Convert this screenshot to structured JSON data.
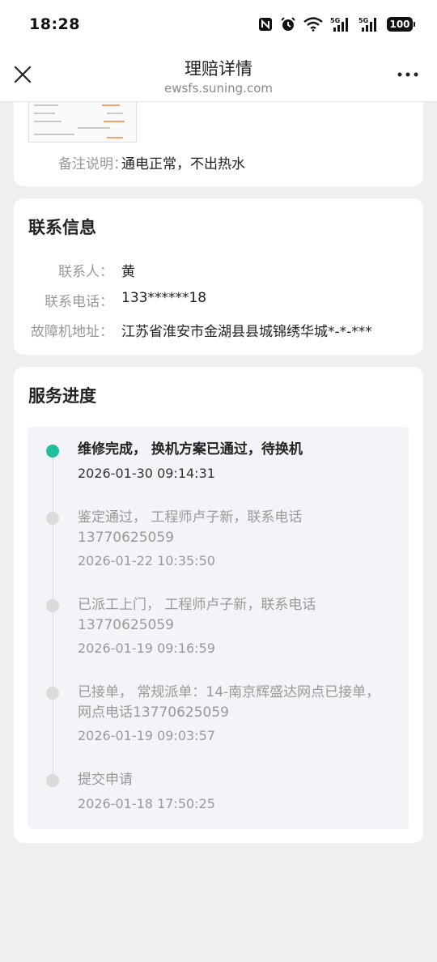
{
  "status_bar": {
    "time": "18:28",
    "battery": "100",
    "icons": [
      "nfc-icon",
      "alarm-icon",
      "wifi-icon",
      "signal-5g-icon",
      "signal-5g-icon"
    ]
  },
  "nav": {
    "title": "理赔详情",
    "subtitle": "ewsfs.suning.com",
    "close_icon": "close-icon",
    "more_icon": "more-icon"
  },
  "claim_card": {
    "remark_label": "备注说明：",
    "remark_value": "通电正常，不出热水"
  },
  "contact": {
    "title": "联系信息",
    "rows": [
      {
        "label": "联系人：",
        "value": "黄"
      },
      {
        "label": "联系电话：",
        "value": "133******18"
      },
      {
        "label": "故障机地址：",
        "value": "江苏省淮安市金湖县县城锦绣华城*-*-***"
      }
    ]
  },
  "progress": {
    "title": "服务进度",
    "steps": [
      {
        "text": "维修完成， 换机方案已通过，待换机",
        "time": "2026-01-30 09:14:31",
        "active": true
      },
      {
        "text": "鉴定通过， 工程师卢子新，联系电话13770625059",
        "time": "2026-01-22 10:35:50",
        "active": false
      },
      {
        "text": "已派工上门， 工程师卢子新，联系电话13770625059",
        "time": "2026-01-19 09:16:59",
        "active": false
      },
      {
        "text": "已接单， 常规派单：14-南京辉盛达网点已接单，网点电话13770625059",
        "time": "2026-01-19 09:03:57",
        "active": false
      },
      {
        "text": "提交申请",
        "time": "2026-01-18 17:50:25",
        "active": false
      }
    ]
  },
  "colors": {
    "active_dot": "#1fbf9c",
    "inactive_dot": "#dadada",
    "background": "#efefef"
  }
}
